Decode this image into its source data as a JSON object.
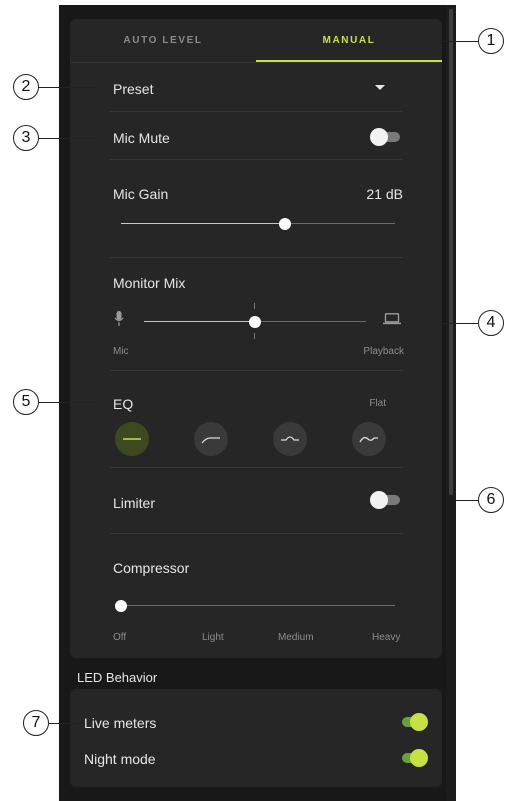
{
  "tabs": [
    {
      "label": "AUTO LEVEL",
      "active": false
    },
    {
      "label": "MANUAL",
      "active": true
    }
  ],
  "preset": {
    "label": "Preset"
  },
  "mic_mute": {
    "label": "Mic Mute",
    "on": false
  },
  "mic_gain": {
    "label": "Mic Gain",
    "value_text": "21 dB",
    "level": 0.6
  },
  "monitor_mix": {
    "label": "Monitor Mix",
    "left_label": "Mic",
    "right_label": "Playback",
    "level": 0.5,
    "left_icon": "microphone-icon",
    "right_icon": "laptop-icon"
  },
  "eq": {
    "label": "EQ",
    "selected_text": "Flat",
    "options": [
      {
        "icon": "eq-flat-icon",
        "active": true
      },
      {
        "icon": "eq-low-shelf-icon",
        "active": false
      },
      {
        "icon": "eq-mid-bump-icon",
        "active": false
      },
      {
        "icon": "eq-presence-icon",
        "active": false
      }
    ]
  },
  "limiter": {
    "label": "Limiter",
    "on": false
  },
  "compressor": {
    "label": "Compressor",
    "level": 0,
    "stops": [
      "Off",
      "Light",
      "Medium",
      "Heavy"
    ]
  },
  "led_behavior": {
    "title": "LED Behavior",
    "items": [
      {
        "label": "Live meters",
        "on": true
      },
      {
        "label": "Night mode",
        "on": true
      }
    ]
  },
  "callouts": [
    "1",
    "2",
    "3",
    "4",
    "5",
    "6",
    "7"
  ],
  "colors": {
    "accent": "#c6e046",
    "background": "#181818",
    "card": "#262626"
  }
}
